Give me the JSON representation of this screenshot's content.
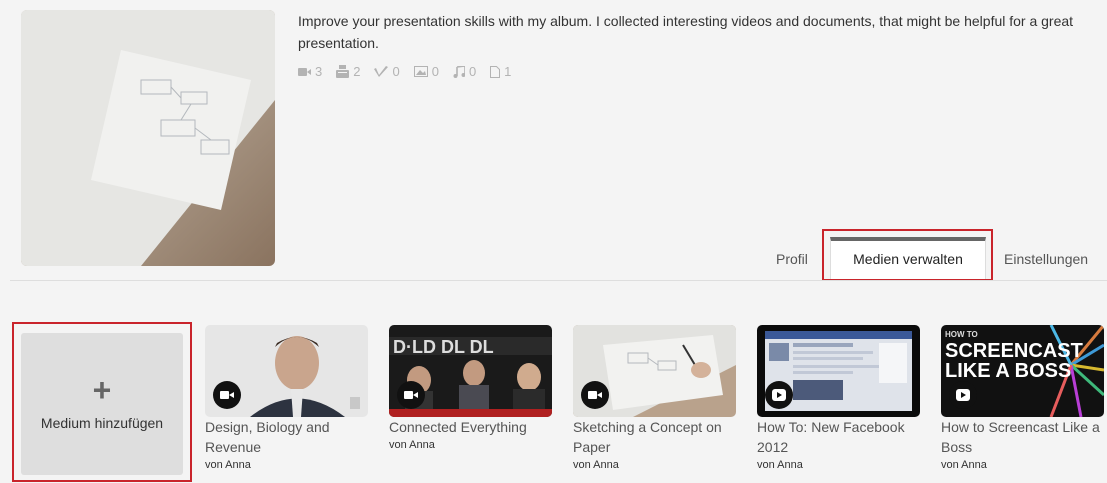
{
  "album": {
    "description": "Improve your presentation skills with my album. I collected interesting videos and documents, that might be helpful for a great presentation.",
    "counts": [
      {
        "icon": "video-camera-icon",
        "value": "3"
      },
      {
        "icon": "youtube-icon",
        "value": "2"
      },
      {
        "icon": "vimeo-icon",
        "value": "0"
      },
      {
        "icon": "image-icon",
        "value": "0"
      },
      {
        "icon": "music-icon",
        "value": "0"
      },
      {
        "icon": "document-icon",
        "value": "1"
      }
    ]
  },
  "tabs": {
    "profil": "Profil",
    "medien_verwalten": "Medien verwalten",
    "einstellungen": "Einstellungen"
  },
  "add_media": {
    "icon": "plus-icon",
    "label": "Medium hinzufügen"
  },
  "media": [
    {
      "title": "Design, Biology and Revenue",
      "author": "von Anna",
      "badge": "video-camera-icon"
    },
    {
      "title": "Connected Everything",
      "author": "von Anna",
      "badge": "video-camera-icon"
    },
    {
      "title": "Sketching a Concept on Paper",
      "author": "von Anna",
      "badge": "video-camera-icon"
    },
    {
      "title": "How To: New Facebook 2012",
      "author": "von Anna",
      "badge": "play-icon"
    },
    {
      "title": "How to Screencast Like a Boss",
      "author": "von Anna",
      "badge": "play-icon"
    }
  ],
  "thumbnail_text": {
    "screencast_line1": "HOW TO",
    "screencast_line2": "SCREENCAST",
    "screencast_line3": "LIKE A BOSS"
  },
  "colors": {
    "highlight": "#c9242b",
    "background": "#f4f4f4",
    "count_icons": "#b3b3b3"
  }
}
